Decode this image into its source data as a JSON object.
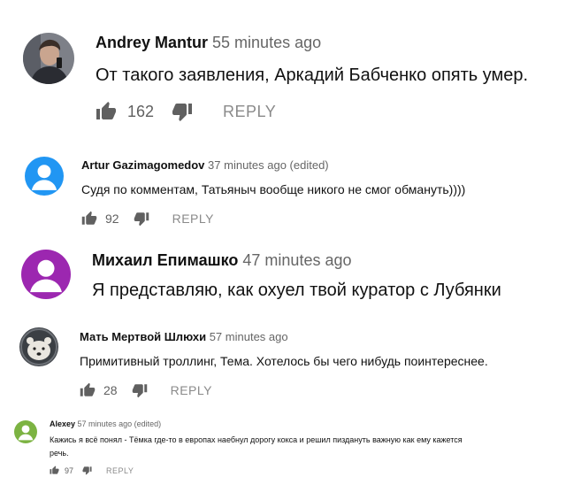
{
  "comments": [
    {
      "author": "Andrey Mantur",
      "time": "55 minutes ago",
      "text": "От такого заявления, Аркадий Бабченко опять умер.",
      "likes": "162",
      "reply": "REPLY",
      "avatar": "photo-avatar"
    },
    {
      "author": "Artur Gazimagomedov",
      "time": "37 minutes ago (edited)",
      "text": "Судя по комментам, Татьяныч вообще никого не смог обмануть))))",
      "likes": "92",
      "reply": "REPLY",
      "avatar": "default-avatar-blue",
      "avatar_color": "#2196f3"
    },
    {
      "author": "Михаил Епимашко",
      "time": "47 minutes ago",
      "text": "Я представляю, как охуел твой куратор с Лубянки",
      "avatar": "default-avatar-purple",
      "avatar_color": "#9c27b0"
    },
    {
      "author": "Мать Мертвой Шлюхи",
      "time": "57 minutes ago",
      "text": "Примитивный троллинг, Тема. Хотелось бы чего нибудь поинтереснее.",
      "likes": "28",
      "reply": "REPLY",
      "avatar": "polar-bear-avatar"
    },
    {
      "author": "Alexey",
      "time": "57 minutes ago (edited)",
      "text_line1": "Кажись я всё понял - Тёмка где-то в европах наебнул дорогу кокса и решил пиздануть важную как ему кажется",
      "text_line2": "речь.",
      "likes": "97",
      "reply": "REPLY",
      "avatar": "default-avatar-green",
      "avatar_color": "#7cb342"
    }
  ]
}
